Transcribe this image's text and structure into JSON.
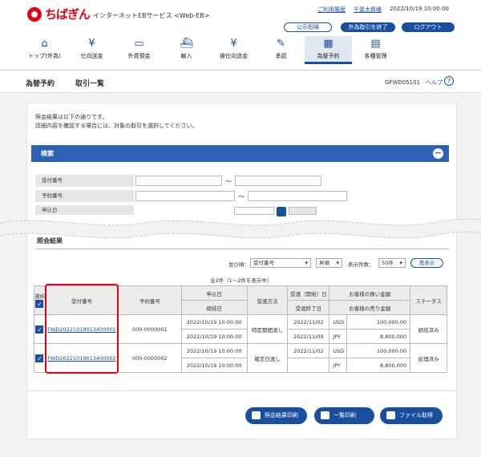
{
  "header": {
    "bank_name": "ちばぎん",
    "service_name": "インターネットEBサービス <Web-EB>",
    "last_use_link": "ご利用履歴",
    "user_name": "千葉太郎様",
    "datetime": "2022/10/19 10:00:00",
    "public_rate_button": "公示相場",
    "fx_end_button": "外為取引を終了",
    "logout_button": "ログアウト"
  },
  "nav": [
    {
      "label": "トップ(外為)",
      "icon": "home-icon"
    },
    {
      "label": "仕向送金",
      "icon": "yen-send-icon"
    },
    {
      "label": "外貨預金",
      "icon": "deposit-icon"
    },
    {
      "label": "輸入",
      "icon": "import-icon"
    },
    {
      "label": "被仕向送金",
      "icon": "yen-receive-icon"
    },
    {
      "label": "承認",
      "icon": "approve-icon"
    },
    {
      "label": "為替予約",
      "icon": "calendar-icon"
    },
    {
      "label": "各種管理",
      "icon": "manage-icon"
    }
  ],
  "page": {
    "section": "為替予約",
    "title": "取引一覧",
    "screen_id": "GFWD05101",
    "help": "ヘルプ",
    "help_icon": "?"
  },
  "intro": {
    "line1": "照会結果は以下の通りです。",
    "line2": "詳細内容を確認する場合には、対象の取引を選択してください。"
  },
  "search": {
    "title": "検索",
    "collapse": "−",
    "receipt_label": "受付番号",
    "reserve_label": "予約番号",
    "apply_date_label": "申込日",
    "range_sep": "〜"
  },
  "results": {
    "title": "照会結果",
    "sort_label": "並び順：",
    "sort_value": "受付番号",
    "order_value": "昇順",
    "per_page_label": "表示件数：",
    "per_page_value": "50件",
    "redisplay_button": "再表示",
    "count_text": "全2件（1〜2件を表示中）",
    "headers": {
      "select": "選択",
      "receipt_no": "受付番号",
      "reserve_no": "予約番号",
      "apply_date": "申込日",
      "finish_date": "締結日",
      "delivery_method": "受渡方法",
      "delivery_start": "受渡（開始）日",
      "delivery_end": "受渡終了日",
      "buy_amount": "お客様の買い金額",
      "sell_amount": "お客様の売り金額",
      "status": "ステータス"
    },
    "rows": [
      {
        "receipt_no": "FWD20221019013400001",
        "reserve_no": "000-0000001",
        "apply_date": "2022/10/19 10:00:00",
        "finish_date": "2022/10/19 10:00:00",
        "delivery_method": "特定期間渡し",
        "delivery_start": "2022/11/02",
        "delivery_end": "2022/11/09",
        "buy_ccy": "USD",
        "buy_amt": "100,000.00",
        "sell_ccy": "JPY",
        "sell_amt": "8,800,000",
        "status": "締結済み"
      },
      {
        "receipt_no": "FWD20221019013400002",
        "reserve_no": "000-0000002",
        "apply_date": "2022/10/19 10:00:00",
        "finish_date": "2022/10/19 10:00:00",
        "delivery_method": "確定日渡し",
        "delivery_start": "2022/11/02",
        "delivery_end": "",
        "buy_ccy": "USD",
        "buy_amt": "100,000.00",
        "sell_ccy": "JPY",
        "sell_amt": "8,800,000",
        "status": "処理済み"
      }
    ]
  },
  "buttons": {
    "print_results": "照会結果印刷",
    "print_list": "一覧印刷",
    "file_get": "ファイル取得"
  },
  "colors": {
    "brand": "#e60012",
    "primary": "#1a4fa0",
    "search_bar": "#2b62b5"
  }
}
